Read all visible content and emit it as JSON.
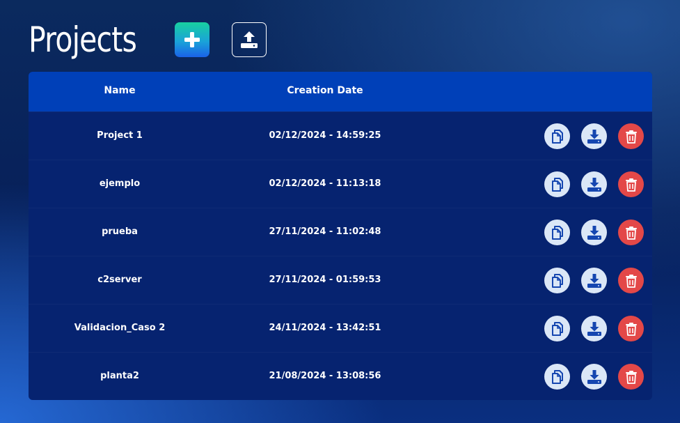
{
  "header": {
    "title": "Projects",
    "add_icon": "plus-icon",
    "upload_icon": "upload-icon"
  },
  "table": {
    "columns": {
      "name": "Name",
      "date": "Creation Date"
    },
    "rows": [
      {
        "name": "Project 1",
        "date": "02/12/2024 - 14:59:25"
      },
      {
        "name": "ejemplo",
        "date": "02/12/2024 - 11:13:18"
      },
      {
        "name": "prueba",
        "date": "27/11/2024 - 11:02:48"
      },
      {
        "name": "c2server",
        "date": "27/11/2024 - 01:59:53"
      },
      {
        "name": "Validacion_Caso 2",
        "date": "24/11/2024 - 13:42:51"
      },
      {
        "name": "planta2",
        "date": "21/08/2024 - 13:08:56"
      }
    ],
    "row_actions": [
      "copy-icon",
      "download-icon",
      "trash-icon"
    ]
  },
  "colors": {
    "header_bg": "#0040b8",
    "table_bg": "#062370",
    "delete": "#e34848",
    "action_light": "#dbe7f7"
  }
}
